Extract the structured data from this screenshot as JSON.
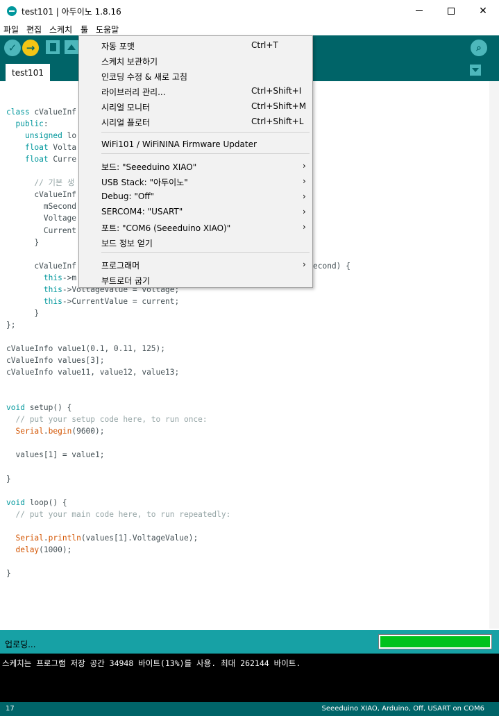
{
  "window": {
    "title": "test101 | 아두이노 1.8.16"
  },
  "menubar": {
    "items": [
      "파일",
      "편집",
      "스케치",
      "툴",
      "도움말"
    ]
  },
  "tabs": {
    "active": "test101"
  },
  "code": {
    "lines": [
      "class cValueInf",
      "  public:",
      "    unsigned lo",
      "    float Volta",
      "    float Curre",
      "",
      "      // 기본 생",
      "      cValueInf",
      "        mSecond",
      "        Voltage",
      "        Current",
      "      }",
      "",
      "      cValueInf",
      "        this->m",
      "        this->VoltageValue = voltage;",
      "        this->CurrentValue = current;",
      "      }",
      "};",
      "",
      "cValueInfo value1(0.1, 0.11, 125);",
      "cValueInfo values[3];",
      "cValueInfo value11, value12, value13;",
      "",
      "",
      "void setup() {",
      "  // put your setup code here, to run once:",
      "  Serial.begin(9600);",
      "",
      "  values[1] = value1;",
      "",
      "}",
      "",
      "void loop() {",
      "  // put your main code here, to run repeatedly:",
      "",
      "  Serial.println(values[1].VoltageValue);",
      "  delay(1000);",
      "",
      "}"
    ],
    "hidden_tail": "econd) {"
  },
  "status": {
    "text": "업로딩...",
    "progress": 1.0
  },
  "console": {
    "message": "스케치는 프로그램 저장 공간 34948 바이트(13%)를 사용. 최대 262144 바이트."
  },
  "footer": {
    "line_number": "17",
    "board_info": "Seeeduino XIAO, Arduino, Off, USART on COM6"
  },
  "tools_menu": {
    "items": [
      {
        "label": "자동 포맷",
        "shortcut": "Ctrl+T"
      },
      {
        "label": "스케치 보관하기",
        "shortcut": ""
      },
      {
        "label": "인코딩 수정 & 새로 고침",
        "shortcut": ""
      },
      {
        "label": "라이브러리 관리...",
        "shortcut": "Ctrl+Shift+I"
      },
      {
        "label": "시리얼 모니터",
        "shortcut": "Ctrl+Shift+M"
      },
      {
        "label": "시리얼 플로터",
        "shortcut": "Ctrl+Shift+L"
      },
      {
        "label": "WiFi101 / WiFiNINA Firmware Updater",
        "shortcut": ""
      },
      {
        "label": "보드: \"Seeeduino XIAO\"",
        "shortcut": ""
      },
      {
        "label": "USB Stack: \"아두이노\"",
        "shortcut": ""
      },
      {
        "label": "Debug: \"Off\"",
        "shortcut": ""
      },
      {
        "label": "SERCOM4: \"USART\"",
        "shortcut": ""
      },
      {
        "label": "포트: \"COM6 (Seeeduino XIAO)\"",
        "shortcut": ""
      },
      {
        "label": "보드 정보 얻기",
        "shortcut": ""
      },
      {
        "label": "프로그래머",
        "shortcut": ""
      },
      {
        "label": "부트로더 굽기",
        "shortcut": ""
      }
    ],
    "submenu_arrow": "›"
  },
  "colors": {
    "toolbar": "#006468",
    "status": "#17a1a5",
    "keyword": "#00979c",
    "function": "#d35400",
    "comment": "#95a5a6",
    "progress": "#00c21c"
  },
  "icons": [
    "arduino-logo-icon",
    "verify-check-icon",
    "upload-arrow-icon",
    "new-sketch-icon",
    "save-sketch-icon",
    "serial-monitor-icon",
    "tab-menu-chevron-icon"
  ]
}
